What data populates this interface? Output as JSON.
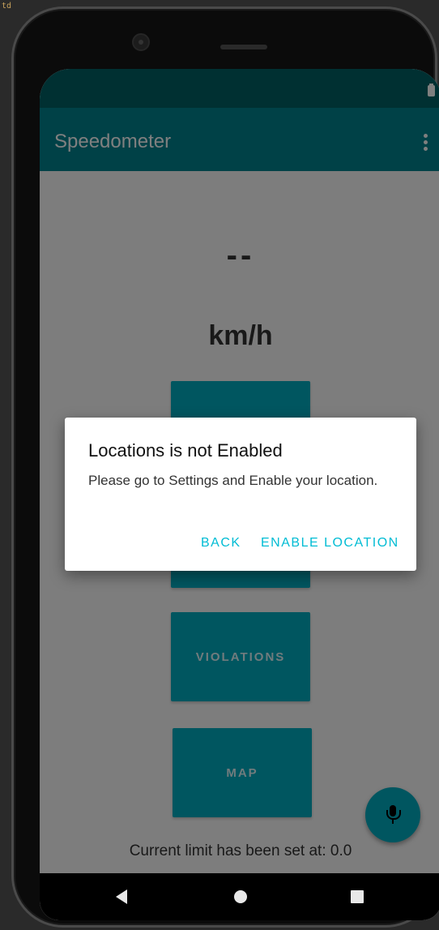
{
  "corner_text": "td",
  "app": {
    "title": "Speedometer"
  },
  "speed": {
    "value": "--",
    "unit": "km/h"
  },
  "buttons": {
    "violations_label": "VIOLATIONS",
    "map_label": "MAP"
  },
  "limit_text": "Current limit has been set at: 0.0",
  "dialog": {
    "title": "Locations is not Enabled",
    "message": "Please go to Settings and Enable your location.",
    "back_label": "BACK",
    "enable_label": "ENABLE LOCATION"
  },
  "colors": {
    "status_bar": "#006064",
    "app_bar": "#00838f",
    "button": "#00acc1",
    "dialog_button_text": "#00bcd4"
  }
}
